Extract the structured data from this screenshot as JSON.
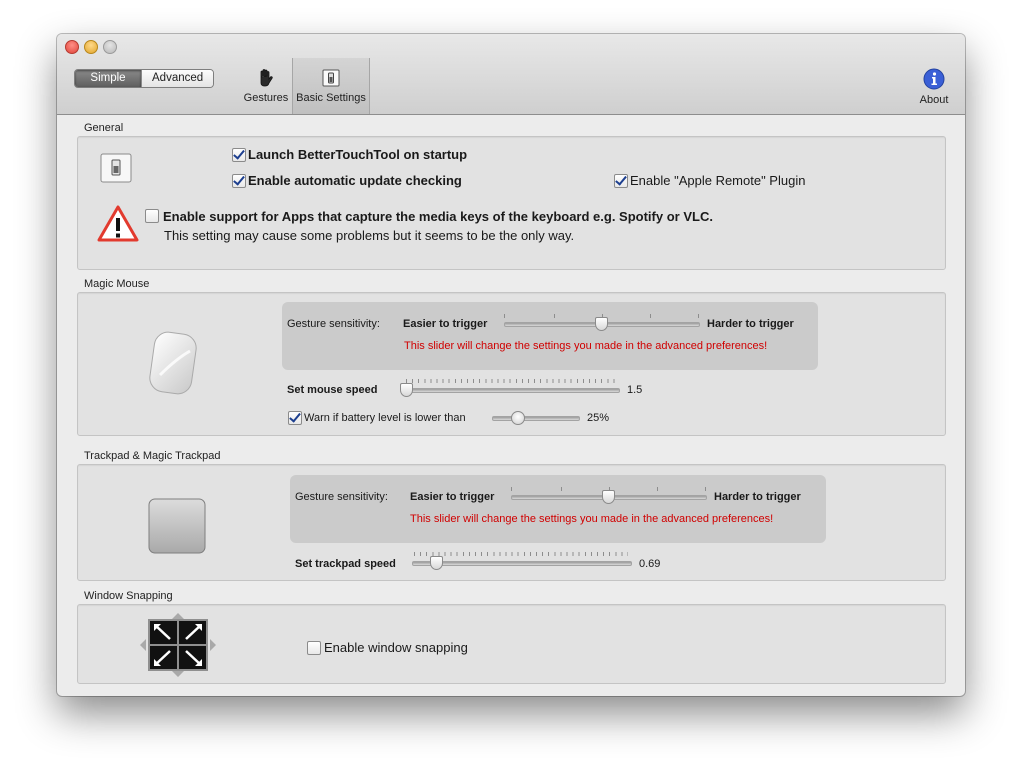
{
  "toolbar": {
    "mode_simple": "Simple",
    "mode_advanced": "Advanced",
    "gestures_label": "Gestures",
    "basic_settings_label": "Basic Settings",
    "about_label": "About"
  },
  "general": {
    "section_title": "General",
    "launch_on_startup": "Launch BetterTouchTool on startup",
    "auto_update": "Enable automatic update checking",
    "apple_remote": "Enable \"Apple Remote\" Plugin",
    "media_keys": "Enable support for Apps that capture the media keys of the keyboard e.g. Spotify or VLC.",
    "media_keys_note": "This setting may cause some problems but it seems to be the only way.",
    "launch_checked": true,
    "auto_update_checked": true,
    "apple_remote_checked": true,
    "media_keys_checked": false
  },
  "magic_mouse": {
    "section_title": "Magic Mouse",
    "gesture_sensitivity_label": "Gesture sensitivity:",
    "easier_label": "Easier to trigger",
    "harder_label": "Harder to trigger",
    "warning": "This slider will change the settings you made in the advanced preferences!",
    "speed_label": "Set mouse speed",
    "speed_value": "1.5",
    "battery_label": "Warn if battery level is lower than",
    "battery_value": "25%",
    "battery_checked": true
  },
  "trackpad": {
    "section_title": "Trackpad & Magic Trackpad",
    "gesture_sensitivity_label": "Gesture sensitivity:",
    "easier_label": "Easier to trigger",
    "harder_label": "Harder to trigger",
    "warning": "This slider will change the settings you made in the advanced preferences!",
    "speed_label": "Set trackpad speed",
    "speed_value": "0.69"
  },
  "window_snapping": {
    "section_title": "Window Snapping",
    "enable_label": "Enable window snapping",
    "enable_checked": false
  },
  "colors": {
    "warning_red": "#d00000",
    "checkbox_check": "#1d3f8f",
    "about_blue": "#3a5fd6"
  }
}
